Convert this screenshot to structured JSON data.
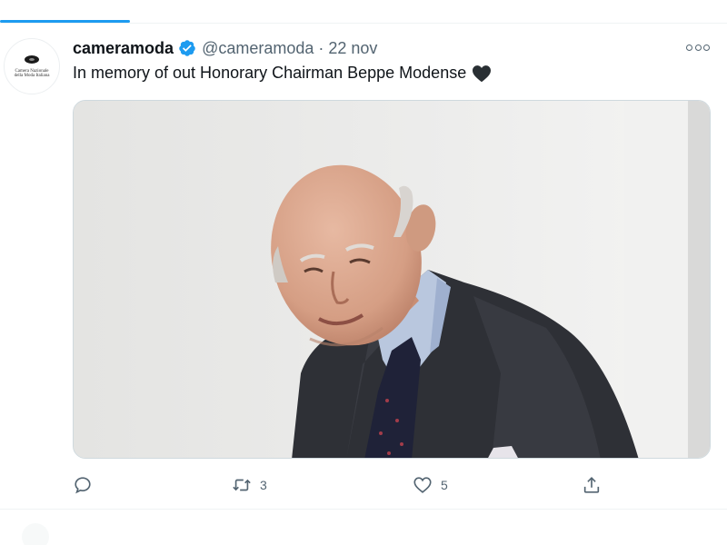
{
  "tweet": {
    "display_name": "cameramoda",
    "handle": "@cameramoda",
    "separator": "·",
    "date": "22 nov",
    "text": "In memory of out Honorary Chairman Beppe Modense",
    "avatar_text_line1": "Camera Nazionale",
    "avatar_text_line2": "della Moda Italiana",
    "avatar_icon": "cnmi-logo",
    "verified_icon": "verified-badge-icon",
    "emoji_icon": "black-heart-icon",
    "media_alt_icon": "photo"
  },
  "actions": {
    "reply_count": "",
    "retweet_count": "3",
    "like_count": "5",
    "share_count": ""
  },
  "colors": {
    "accent": "#1d9bf0",
    "text_primary": "#0f1419",
    "text_secondary": "#536471",
    "border": "#cfd9de"
  }
}
